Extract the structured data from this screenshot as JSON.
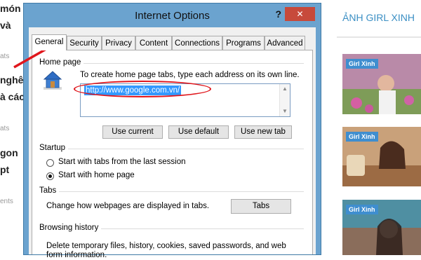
{
  "left_strip": {
    "lines": [
      "món",
      "và",
      "nghêu",
      "à các",
      "gon",
      "pt"
    ],
    "meta": [
      "ats",
      "ats",
      "ats",
      "ents"
    ]
  },
  "sidebar": {
    "heading": "ẢNH GIRL XINH",
    "thumb_tags": [
      "Girl Xinh",
      "Girl Xinh",
      "Girl Xinh"
    ]
  },
  "dialog": {
    "title": "Internet Options",
    "help": "?",
    "close": "✕",
    "tabs": [
      "General",
      "Security",
      "Privacy",
      "Content",
      "Connections",
      "Programs",
      "Advanced"
    ],
    "home_page": {
      "label": "Home page",
      "instruction": "To create home page tabs, type each address on its own line.",
      "url": "http://www.google.com.vn/",
      "buttons": [
        "Use current",
        "Use default",
        "Use new tab"
      ]
    },
    "startup": {
      "label": "Startup",
      "options": [
        "Start with tabs from the last session",
        "Start with home page"
      ],
      "selected_index": 1
    },
    "tabs_section": {
      "label": "Tabs",
      "description": "Change how webpages are displayed in tabs.",
      "button": "Tabs"
    },
    "history": {
      "label": "Browsing history",
      "description": "Delete temporary files, history, cookies, saved passwords, and web form information."
    }
  },
  "annotation_color": "#e0161c"
}
